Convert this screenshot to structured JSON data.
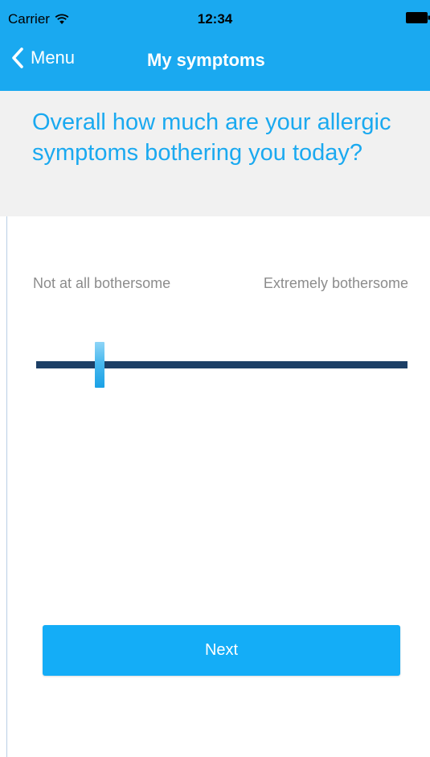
{
  "status_bar": {
    "carrier": "Carrier",
    "time": "12:34",
    "wifi_icon": "wifi-icon",
    "battery_icon": "battery-icon"
  },
  "nav": {
    "back_label": "Menu",
    "back_icon": "chevron-left-icon",
    "title": "My symptoms"
  },
  "question": "Overall how much are your allergic symptoms bothering you today?",
  "slider": {
    "min_label": "Not at all bothersome",
    "max_label": "Extremely bothersome",
    "value_fraction": 0.17
  },
  "next_button": {
    "label": "Next"
  },
  "colors": {
    "primary": "#1aa9f0",
    "button": "#14adf7",
    "track": "#1c3f66",
    "panel_bg": "#f1f1f1",
    "label_text": "#8c8c8c"
  }
}
